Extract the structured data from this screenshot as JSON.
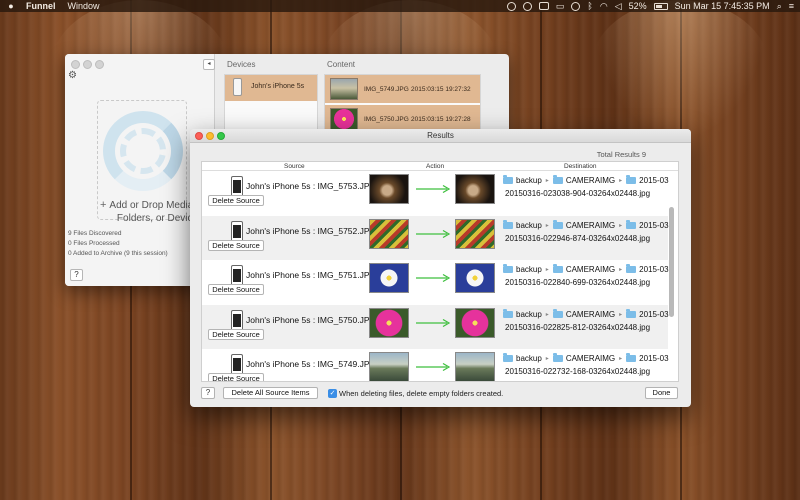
{
  "menubar": {
    "app_name": "Funnel",
    "menus": [
      "Window"
    ],
    "battery": "52%",
    "clock": "Sun Mar 15  7:45:35 PM",
    "icons": [
      "apple-icon",
      "adobe-icon",
      "user-icon",
      "monitor-icon",
      "airplay-icon",
      "time-machine-icon",
      "bluetooth-icon",
      "wifi-icon",
      "volume-icon",
      "battery-icon",
      "search-icon",
      "list-icon"
    ]
  },
  "main_window": {
    "devices_header": "Devices",
    "content_header": "Content",
    "device_name": "John's iPhone 5s",
    "drop_text_line1": "Add or Drop Media Files,",
    "drop_text_line2": "Folders, or Devices",
    "stats": [
      "9 Files Discovered",
      "0 Files Processed",
      "0 Added to Archive (9 this session)"
    ],
    "help_label": "?",
    "collapse_label": "◂",
    "content_items": [
      {
        "name": "IMG_5749.JPG",
        "date": "2015:03:15 19:27:32"
      },
      {
        "name": "IMG_5750.JPG",
        "date": "2015:03:15 19:27:28"
      }
    ]
  },
  "results": {
    "title": "Results",
    "total": "Total Results 9",
    "columns": [
      "Source",
      "Action",
      "Destination"
    ],
    "rows": [
      {
        "source": "John's iPhone 5s : IMG_5753.JPG",
        "button": "Delete Source",
        "path": [
          "backup",
          "CAMERAIMG",
          "2015-03"
        ],
        "file": "20150316-023038-904-03264x02448.jpg",
        "thumb": "cat"
      },
      {
        "source": "John's iPhone 5s : IMG_5752.JPG",
        "button": "Delete Source",
        "path": [
          "backup",
          "CAMERAIMG",
          "2015-03"
        ],
        "file": "20150316-022946-874-03264x02448.jpg",
        "thumb": "tulips"
      },
      {
        "source": "John's iPhone 5s : IMG_5751.JPG",
        "button": "Delete Source",
        "path": [
          "backup",
          "CAMERAIMG",
          "2015-03"
        ],
        "file": "20150316-022840-699-03264x02448.jpg",
        "thumb": "daisy"
      },
      {
        "source": "John's iPhone 5s : IMG_5750.JPG",
        "button": "Delete Source",
        "path": [
          "backup",
          "CAMERAIMG",
          "2015-03"
        ],
        "file": "20150316-022825-812-03264x02448.jpg",
        "thumb": "pink-flower"
      },
      {
        "source": "John's iPhone 5s : IMG_5749.JPG",
        "button": "Delete Source",
        "path": [
          "backup",
          "CAMERAIMG",
          "2015-03"
        ],
        "file": "20150316-022732-168-03264x02448.jpg",
        "thumb": "lake"
      }
    ],
    "footer": {
      "help_label": "?",
      "delete_all_label": "Delete All Source Items",
      "checkbox_label": "When deleting files, delete empty folders created.",
      "checkbox_checked": true,
      "done_label": "Done"
    }
  },
  "colors": {
    "selection": "#e0b892",
    "arrow": "#3fbf3f",
    "folder": "#7cbde8",
    "checkbox": "#3a8ee6"
  }
}
